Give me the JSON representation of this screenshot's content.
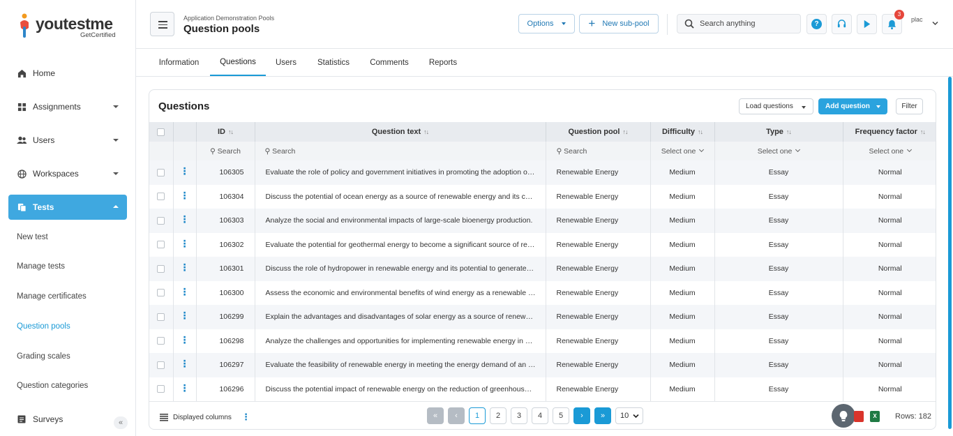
{
  "brand": {
    "name": "youtestme",
    "tagline": "GetCertified"
  },
  "sidebar": {
    "items": [
      {
        "label": "Home",
        "icon": "home-icon"
      },
      {
        "label": "Assignments",
        "icon": "assignments-icon"
      },
      {
        "label": "Users",
        "icon": "users-icon"
      },
      {
        "label": "Workspaces",
        "icon": "globe-icon"
      },
      {
        "label": "Tests",
        "icon": "tests-icon"
      },
      {
        "label": "Surveys",
        "icon": "surveys-icon"
      }
    ],
    "sub_items": [
      "New test",
      "Manage tests",
      "Manage certificates",
      "Question pools",
      "Grading scales",
      "Question categories"
    ],
    "collapse_label": "«"
  },
  "header": {
    "breadcrumb": "Application Demonstration Pools",
    "title": "Question pools",
    "options_label": "Options",
    "new_subpool_label": "New sub-pool",
    "search_placeholder": "Search anything",
    "notifications_count": "3",
    "avatar_alt": "plac"
  },
  "tabs": [
    "Information",
    "Questions",
    "Users",
    "Statistics",
    "Comments",
    "Reports"
  ],
  "panel": {
    "title": "Questions",
    "load_label": "Load questions",
    "add_label": "Add question",
    "filter_label": "Filter"
  },
  "table": {
    "columns": [
      "ID",
      "Question text",
      "Question pool",
      "Difficulty",
      "Type",
      "Frequency factor"
    ],
    "filters": [
      "Search",
      "Search",
      "Search",
      "Select one",
      "Select one",
      "Select one"
    ],
    "rows": [
      [
        "106305",
        "Evaluate the role of policy and government initiatives in promoting the adoption of renewable energy.",
        "Renewable Energy",
        "Medium",
        "Essay",
        "Normal"
      ],
      [
        "106304",
        "Discuss the potential of ocean energy as a source of renewable energy and its challenges.",
        "Renewable Energy",
        "Medium",
        "Essay",
        "Normal"
      ],
      [
        "106303",
        "Analyze the social and environmental impacts of large-scale bioenergy production.",
        "Renewable Energy",
        "Medium",
        "Essay",
        "Normal"
      ],
      [
        "106302",
        "Evaluate the potential for geothermal energy to become a significant source of renewable energy.",
        "Renewable Energy",
        "Medium",
        "Essay",
        "Normal"
      ],
      [
        "106301",
        "Discuss the role of hydropower in renewable energy and its potential to generate electricity.",
        "Renewable Energy",
        "Medium",
        "Essay",
        "Normal"
      ],
      [
        "106300",
        "Assess the economic and environmental benefits of wind energy as a renewable source.",
        "Renewable Energy",
        "Medium",
        "Essay",
        "Normal"
      ],
      [
        "106299",
        "Explain the advantages and disadvantages of solar energy as a source of renewable energy.",
        "Renewable Energy",
        "Medium",
        "Essay",
        "Normal"
      ],
      [
        "106298",
        "Analyze the challenges and opportunities for implementing renewable energy in developing countries.",
        "Renewable Energy",
        "Medium",
        "Essay",
        "Normal"
      ],
      [
        "106297",
        "Evaluate the feasibility of renewable energy in meeting the energy demand of an entire country.",
        "Renewable Energy",
        "Medium",
        "Essay",
        "Normal"
      ],
      [
        "106296",
        "Discuss the potential impact of renewable energy on the reduction of greenhouse gas emissions.",
        "Renewable Energy",
        "Medium",
        "Essay",
        "Normal"
      ]
    ]
  },
  "footer": {
    "displayed_columns_label": "Displayed columns",
    "pages": [
      "1",
      "2",
      "3",
      "4",
      "5"
    ],
    "current_page": "1",
    "per_page": "10",
    "rows_label": "Rows: 182"
  }
}
